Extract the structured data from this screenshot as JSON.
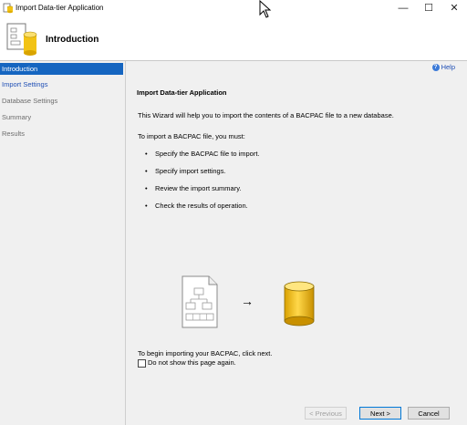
{
  "window": {
    "title": "Import Data-tier Application",
    "minimize": "—",
    "maximize": "☐",
    "close": "✕"
  },
  "header": {
    "title": "Introduction"
  },
  "sidebar": {
    "items": [
      {
        "label": "Introduction",
        "state": "active"
      },
      {
        "label": "Import Settings",
        "state": "link"
      },
      {
        "label": "Database Settings",
        "state": "disabled"
      },
      {
        "label": "Summary",
        "state": "disabled"
      },
      {
        "label": "Results",
        "state": "disabled"
      }
    ]
  },
  "main": {
    "help_label": "Help",
    "section_title": "Import Data-tier Application",
    "intro": "This Wizard will help you to import the contents of a BACPAC file to a new database.",
    "steps_intro": "To import a BACPAC file, you must:",
    "steps": [
      "Specify the BACPAC file to import.",
      "Specify import settings.",
      "Review the import summary.",
      "Check the results of operation."
    ],
    "arrow": "→",
    "begin_text": "To begin importing your BACPAC, click next.",
    "checkbox_label": "Do not show this page again.",
    "checkbox_checked": false
  },
  "buttons": {
    "previous": "< Previous",
    "next": "Next >",
    "cancel": "Cancel"
  },
  "colors": {
    "selection": "#1565c0",
    "link": "#1f4fb5",
    "db_yellow": "#f2c315"
  }
}
